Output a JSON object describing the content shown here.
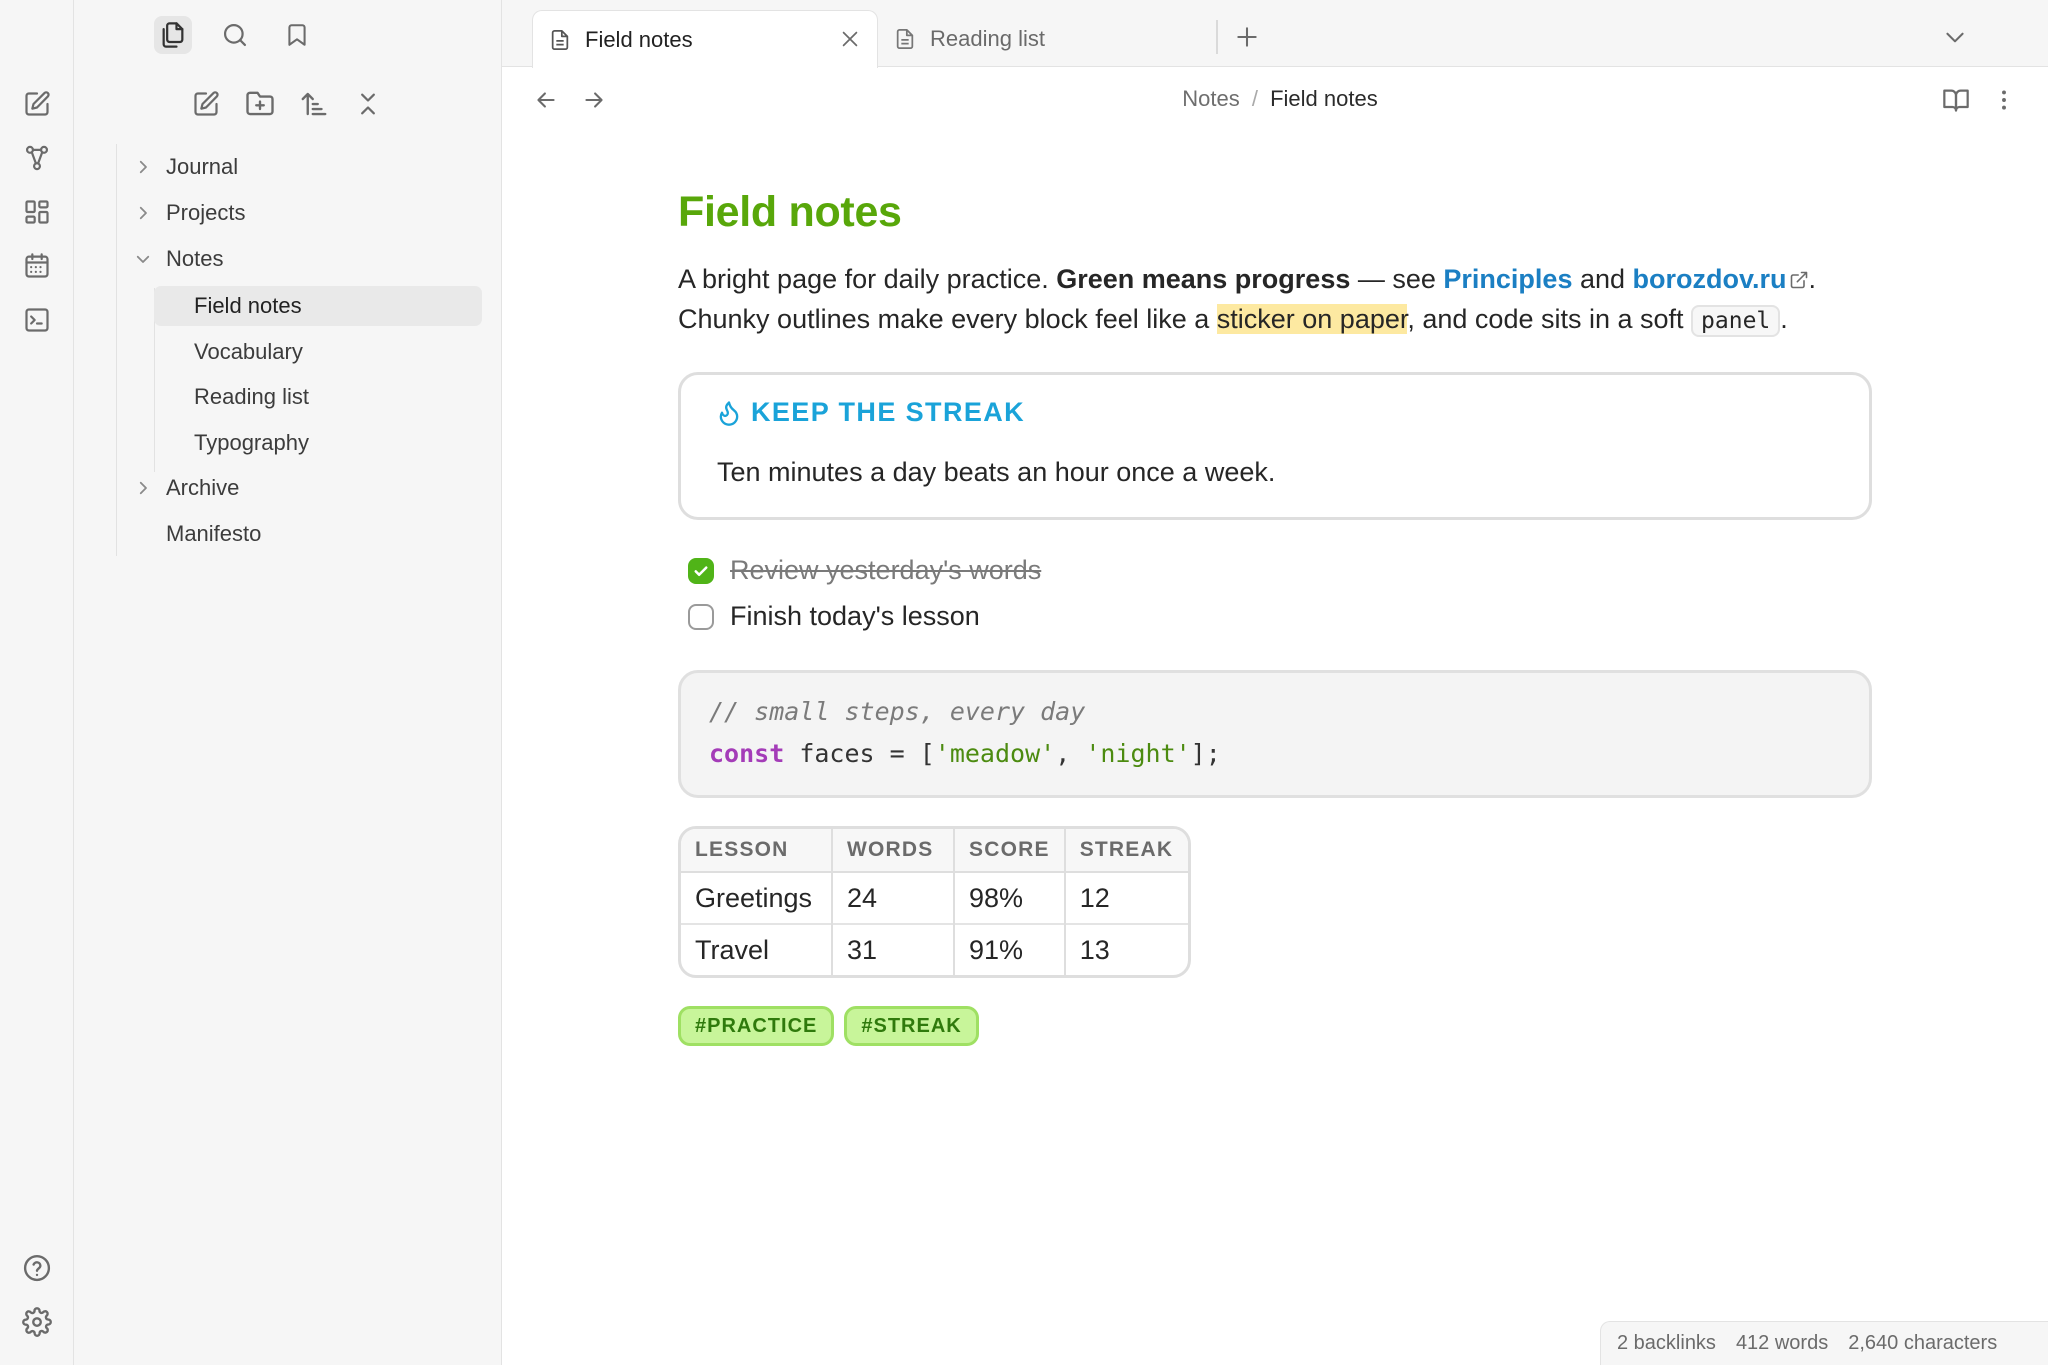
{
  "tabs": [
    {
      "label": "Field notes",
      "active": true
    },
    {
      "label": "Reading list",
      "active": false
    }
  ],
  "breadcrumb": {
    "parent": "Notes",
    "separator": "/",
    "current": "Field notes"
  },
  "sidebar": {
    "tree": [
      {
        "label": "Journal",
        "kind": "folder",
        "expanded": false
      },
      {
        "label": "Projects",
        "kind": "folder",
        "expanded": false
      },
      {
        "label": "Notes",
        "kind": "folder",
        "expanded": true
      },
      {
        "label": "Field notes",
        "kind": "file",
        "selected": true
      },
      {
        "label": "Vocabulary",
        "kind": "file"
      },
      {
        "label": "Reading list",
        "kind": "file"
      },
      {
        "label": "Typography",
        "kind": "file"
      },
      {
        "label": "Archive",
        "kind": "folder",
        "expanded": false
      },
      {
        "label": "Manifesto",
        "kind": "file"
      }
    ]
  },
  "note": {
    "title": "Field notes",
    "p1": {
      "t1": "A bright page for daily practice. ",
      "bold": "Green means progress",
      "t2": " — see ",
      "link1": "Principles",
      "t3": " and ",
      "link2": "borozdov.ru",
      "t4": "."
    },
    "p2": {
      "t1": "Chunky outlines make every block feel like a ",
      "highlight": "sticker on paper",
      "t2": ", and code sits in a soft ",
      "code": "panel",
      "t3": "."
    },
    "callout": {
      "title": "KEEP THE STREAK",
      "body": "Ten minutes a day beats an hour once a week."
    },
    "tasks": [
      {
        "label": "Review yesterday's words",
        "done": true
      },
      {
        "label": "Finish today's lesson",
        "done": false
      }
    ],
    "code": {
      "comment": "// small steps, every day",
      "keyword": "const",
      "ident": " faces = [",
      "str1": "'meadow'",
      "sep": ", ",
      "str2": "'night'",
      "end": "];"
    },
    "table": {
      "headers": [
        "LESSON",
        "WORDS",
        "SCORE",
        "STREAK"
      ],
      "rows": [
        [
          "Greetings",
          "24",
          "98%",
          "12"
        ],
        [
          "Travel",
          "31",
          "91%",
          "13"
        ]
      ]
    },
    "tags": [
      "#PRACTICE",
      "#STREAK"
    ]
  },
  "status": {
    "backlinks": "2 backlinks",
    "words": "412 words",
    "characters": "2,640 characters"
  },
  "colors": {
    "title": "#58a70a",
    "link": "#1b7fc3",
    "callout": "#1aa3d9",
    "highlight": "#fde9a1",
    "tag_bg": "#c8f59a",
    "check": "#50b418"
  },
  "icons": {
    "ribbon": [
      "new-note-icon",
      "graph-icon",
      "canvas-icon",
      "calendar-icon",
      "terminal-icon",
      "help-icon",
      "settings-icon"
    ],
    "sidebar_top": [
      "files-icon",
      "search-icon",
      "bookmark-icon"
    ],
    "explorer_actions": [
      "new-note-icon",
      "new-folder-icon",
      "sort-icon",
      "collapse-icon"
    ]
  }
}
